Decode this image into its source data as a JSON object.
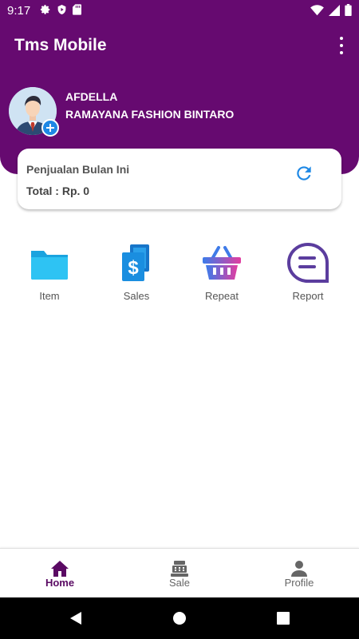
{
  "status_bar": {
    "time": "9:17",
    "icons_left": [
      "gear-icon",
      "shield-icon",
      "sd-card-icon"
    ],
    "icons_right": [
      "wifi-icon",
      "signal-icon",
      "battery-icon"
    ]
  },
  "app_bar": {
    "title": "Tms Mobile",
    "overflow_icon": "more-vert-icon"
  },
  "profile": {
    "name": "AFDELLA",
    "store": "RAMAYANA FASHION BINTARO",
    "add_icon": "plus-icon"
  },
  "sales_card": {
    "title": "Penjualan Bulan Ini",
    "total": "Total : Rp. 0",
    "refresh_icon": "refresh-icon"
  },
  "menu": [
    {
      "label": "Item",
      "icon": "folder-icon"
    },
    {
      "label": "Sales",
      "icon": "dollar-document-icon"
    },
    {
      "label": "Repeat",
      "icon": "basket-icon"
    },
    {
      "label": "Report",
      "icon": "chat-report-icon"
    }
  ],
  "bottom_nav": [
    {
      "label": "Home",
      "icon": "home-icon",
      "active": true
    },
    {
      "label": "Sale",
      "icon": "cash-register-icon",
      "active": false
    },
    {
      "label": "Profile",
      "icon": "person-icon",
      "active": false
    }
  ],
  "colors": {
    "primary": "#660a70",
    "accent_blue": "#1e88e5",
    "active_nav": "#5a0a63"
  }
}
